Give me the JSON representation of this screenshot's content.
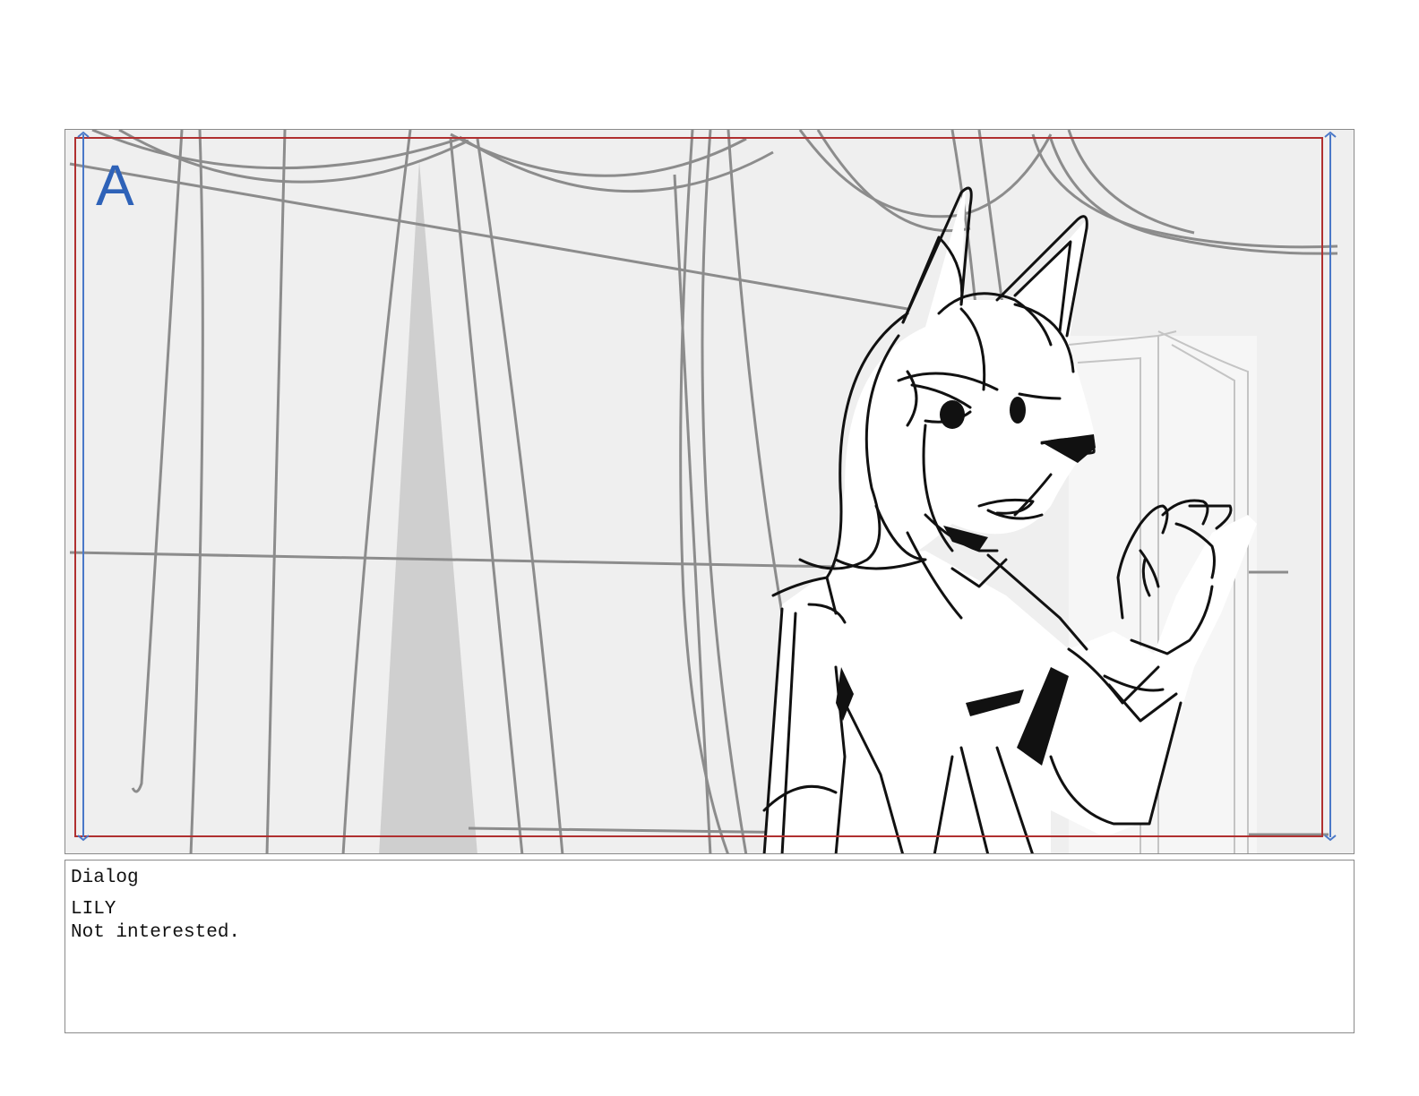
{
  "panel": {
    "label": "A",
    "label_color": "#2e62b8",
    "safe_frame_color": "#b03030",
    "title_safe_color": "#4a78c8",
    "background_color": "#efefef",
    "image": "storyboard-sketch-character-waving-in-front-of-curtains"
  },
  "dialog": {
    "heading": "Dialog",
    "character": "LILY",
    "line": "Not interested."
  }
}
